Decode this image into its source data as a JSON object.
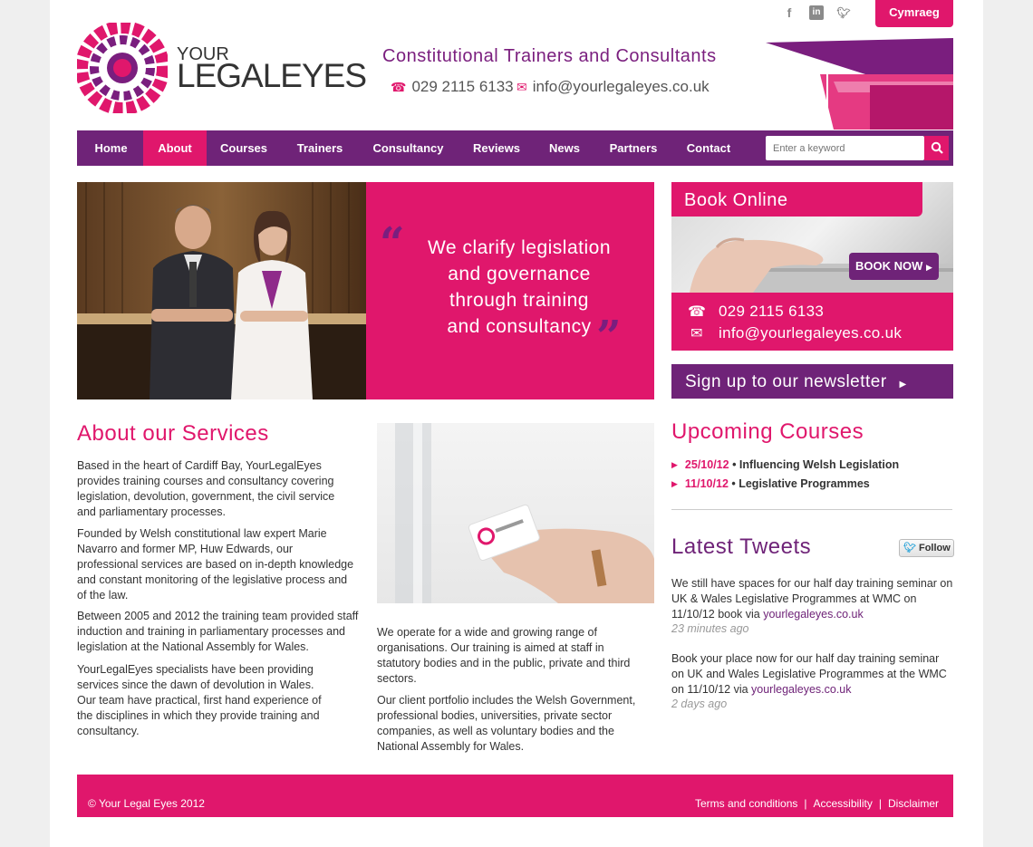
{
  "brand": {
    "your": "YOUR",
    "legaleyes": "LEGALEYES"
  },
  "header": {
    "tagline": "Constitutional Trainers and Consultants",
    "phone": "029 2115 6133",
    "email": "info@yourlegaleyes.co.uk",
    "cymraeg": "Cymraeg",
    "social": [
      "facebook-icon",
      "linkedin-icon",
      "twitter-icon"
    ]
  },
  "nav": {
    "items": [
      "Home",
      "About",
      "Courses",
      "Trainers",
      "Consultancy",
      "Reviews",
      "News",
      "Partners",
      "Contact"
    ],
    "active": "About",
    "search_placeholder": "Enter a keyword"
  },
  "hero": {
    "quote_lines": [
      "We clarify legislation",
      "and governance",
      "through training",
      "and consultancy"
    ]
  },
  "book": {
    "title": "Book Online",
    "button": "BOOK NOW",
    "phone": "029 2115 6133",
    "email": "info@yourlegaleyes.co.uk"
  },
  "newsletter": "Sign up to our newsletter",
  "about": {
    "heading": "About our Services",
    "p1": "Based in the heart of Cardiff Bay, YourLegalEyes provides training courses and consultancy covering legislation, devolution, government, the civil service and parliamentary processes.",
    "p2": "Founded by Welsh constitutional law expert Marie Navarro and former MP, Huw Edwards, our professional services are based on in-depth knowledge and constant monitoring of the legislative process and of the law.",
    "p3": "Between 2005 and 2012 the training team provided staff induction and training in parliamentary processes and legislation at the National Assembly for Wales.",
    "p4": "YourLegalEyes specialists have been providing services since the dawn of devolution in Wales. Our team have practical, first hand experience of the disciplines in which they provide training and consultancy.",
    "p5": "We operate for a wide and growing range of organisations. Our training is aimed at staff in statutory bodies and in the public, private and third sectors.",
    "p6": "Our client portfolio includes the Welsh Government, professional bodies, universities, private sector companies, as well as voluntary bodies and the National Assembly for Wales."
  },
  "courses": {
    "heading": "Upcoming Courses",
    "items": [
      {
        "date": "25/10/12",
        "title": "Influencing Welsh Legislation"
      },
      {
        "date": "11/10/12",
        "title": "Legislative Programmes"
      }
    ]
  },
  "tweets": {
    "heading": "Latest Tweets",
    "follow": "Follow",
    "items": [
      {
        "text": "We still have spaces for our half day training seminar on UK & Wales Legislative Programmes at WMC on 11/10/12 book via ",
        "link": "yourlegaleyes.co.uk",
        "time": "23 minutes ago"
      },
      {
        "text": "Book your place now for our half day training seminar on UK and Wales Legislative Programmes at the WMC on 11/10/12 via ",
        "link": "yourlegaleyes.co.uk",
        "time": "2 days ago"
      }
    ]
  },
  "footer": {
    "copyright": "© Your Legal Eyes 2012",
    "links": [
      "Terms and conditions",
      "Accessibility",
      "Disclaimer"
    ],
    "separator": "|"
  },
  "colors": {
    "pink": "#e0176c",
    "purple": "#6f2378"
  }
}
